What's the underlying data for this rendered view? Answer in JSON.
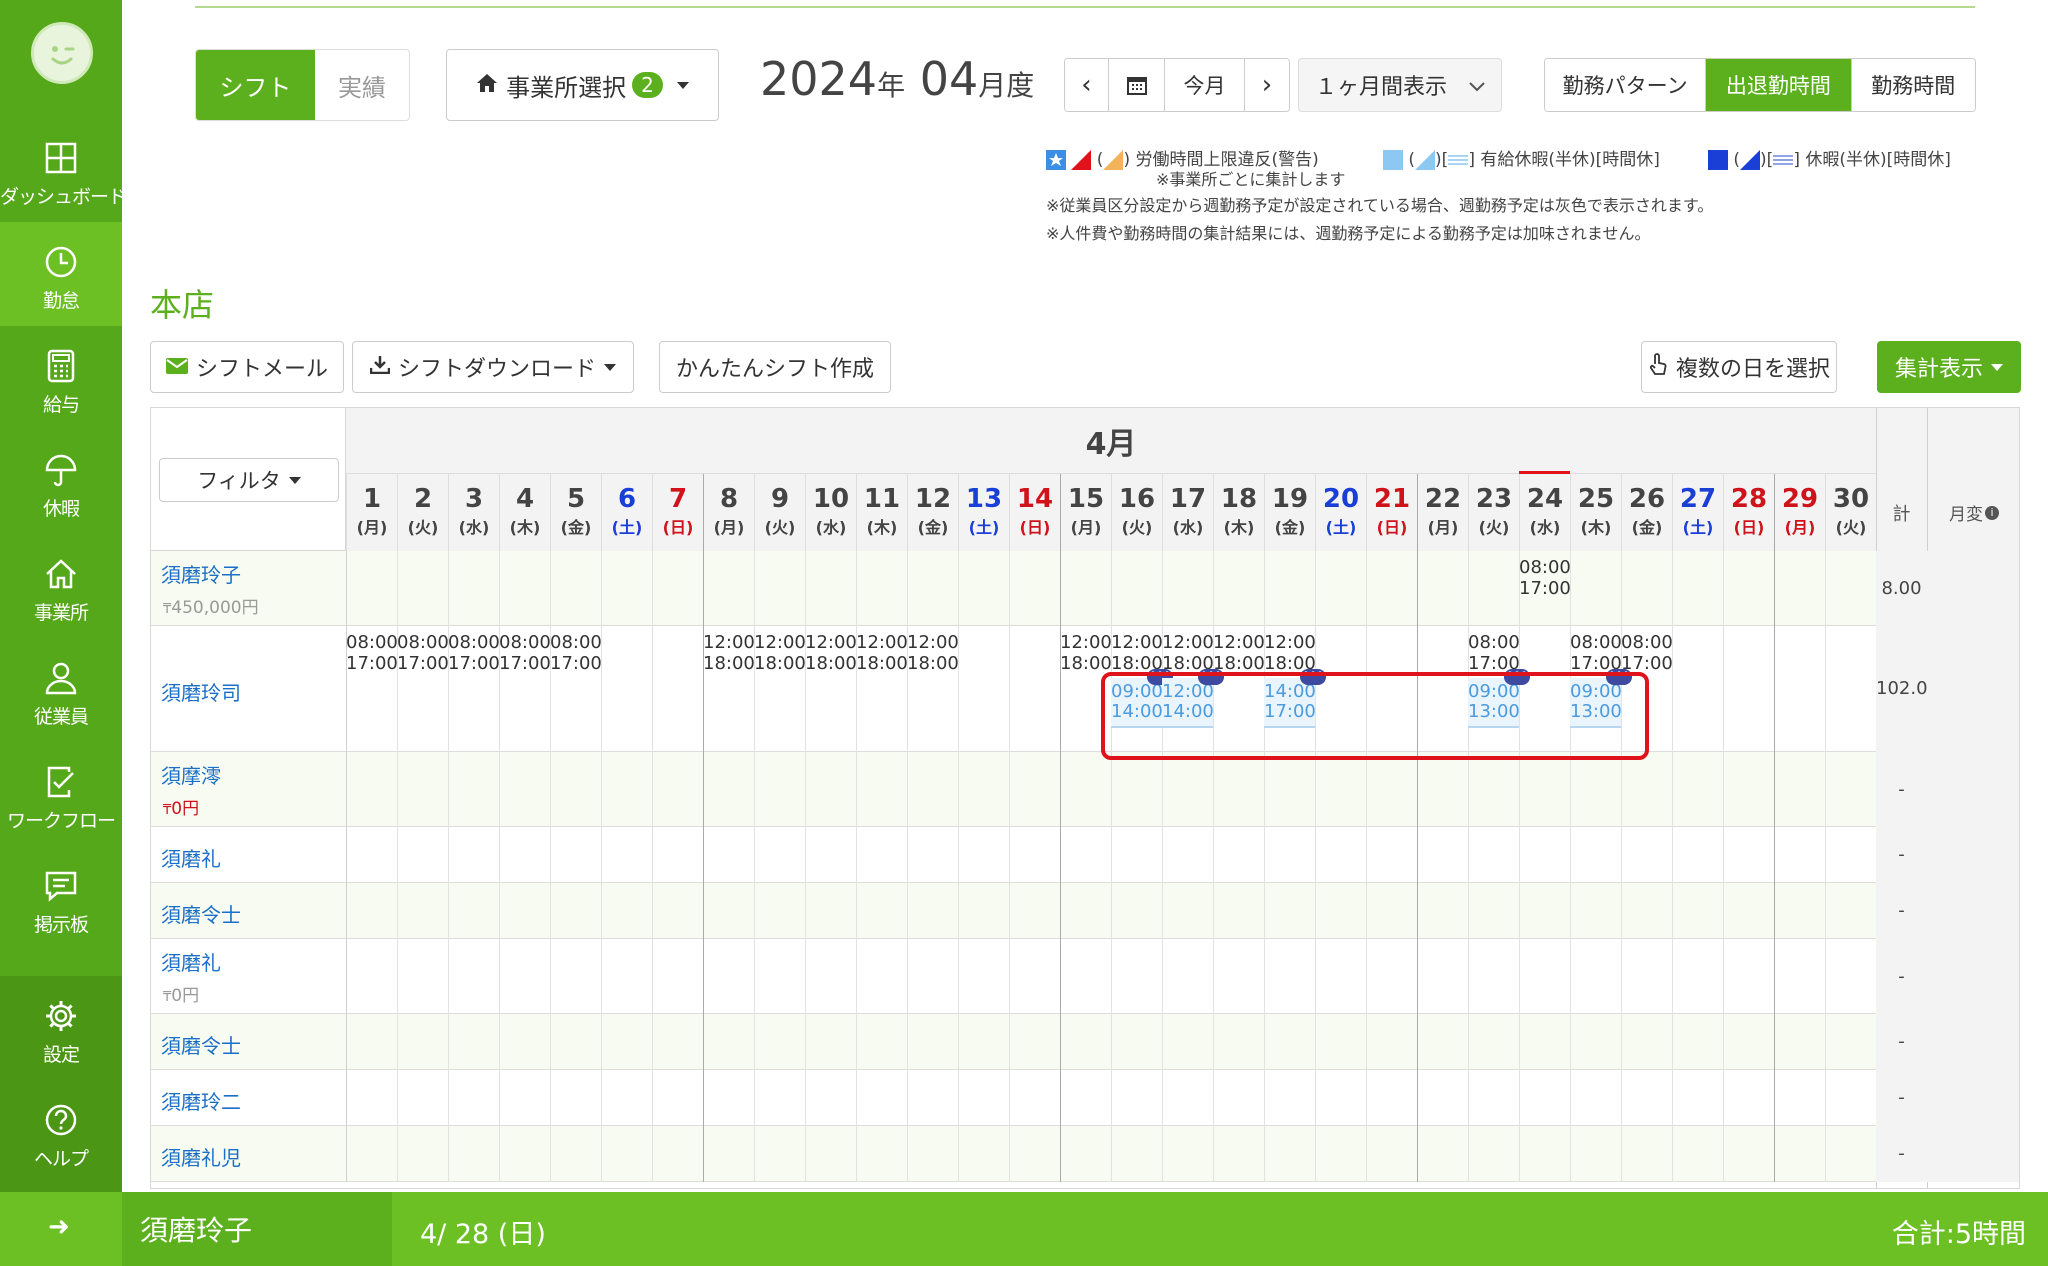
{
  "sidebar": {
    "items": [
      {
        "label": "ダッシュボード",
        "icon": "dashboard-icon"
      },
      {
        "label": "勤怠",
        "icon": "clock-icon"
      },
      {
        "label": "給与",
        "icon": "calculator-icon"
      },
      {
        "label": "休暇",
        "icon": "umbrella-icon"
      },
      {
        "label": "事業所",
        "icon": "home-icon"
      },
      {
        "label": "従業員",
        "icon": "person-icon"
      },
      {
        "label": "ワークフロー",
        "icon": "checklist-icon"
      },
      {
        "label": "掲示板",
        "icon": "chat-icon"
      },
      {
        "label": "設定",
        "icon": "gear-icon"
      },
      {
        "label": "ヘルプ",
        "icon": "help-icon"
      }
    ]
  },
  "toggle": {
    "shift": "シフト",
    "actual": "実績"
  },
  "office_select": {
    "label": "事業所選択",
    "count": "2"
  },
  "period": {
    "year": "2024",
    "year_unit": "年",
    "month": "04",
    "month_unit": "月度"
  },
  "nav": {
    "prev": "‹",
    "today": "今月",
    "next": "›",
    "range": "１ヶ月間表示"
  },
  "view_tabs": [
    "勤務パターン",
    "出退勤時間",
    "勤務時間"
  ],
  "legend": {
    "overtime": "労働時間上限違反(警告)",
    "overtime_note": "※事業所ごとに集計します",
    "paid_leave": "有給休暇(半休)[時間休]",
    "leave": "休暇(半休)[時間休]",
    "note1": "※従業員区分設定から週勤務予定が設定されている場合、週勤務予定は灰色で表示されます。",
    "note2": "※人件費や勤務時間の集計結果には、週勤務予定による勤務予定は加味されません。"
  },
  "store_name": "本店",
  "actions": {
    "shift_mail": "シフトメール",
    "shift_download": "シフトダウンロード",
    "easy_shift": "かんたんシフト作成",
    "multi_select": "複数の日を選択",
    "summary": "集計表示"
  },
  "grid": {
    "filter": "フィルタ",
    "month": "4月",
    "total_header": "計",
    "monthly_change_header": "月変",
    "days": [
      {
        "d": "1",
        "w": "(月)",
        "c": ""
      },
      {
        "d": "2",
        "w": "(火)",
        "c": ""
      },
      {
        "d": "3",
        "w": "(水)",
        "c": ""
      },
      {
        "d": "4",
        "w": "(木)",
        "c": ""
      },
      {
        "d": "5",
        "w": "(金)",
        "c": ""
      },
      {
        "d": "6",
        "w": "(土)",
        "c": "sat"
      },
      {
        "d": "7",
        "w": "(日)",
        "c": "sun"
      },
      {
        "d": "8",
        "w": "(月)",
        "c": ""
      },
      {
        "d": "9",
        "w": "(火)",
        "c": ""
      },
      {
        "d": "10",
        "w": "(水)",
        "c": ""
      },
      {
        "d": "11",
        "w": "(木)",
        "c": ""
      },
      {
        "d": "12",
        "w": "(金)",
        "c": ""
      },
      {
        "d": "13",
        "w": "(土)",
        "c": "sat"
      },
      {
        "d": "14",
        "w": "(日)",
        "c": "sun"
      },
      {
        "d": "15",
        "w": "(月)",
        "c": ""
      },
      {
        "d": "16",
        "w": "(火)",
        "c": ""
      },
      {
        "d": "17",
        "w": "(水)",
        "c": ""
      },
      {
        "d": "18",
        "w": "(木)",
        "c": ""
      },
      {
        "d": "19",
        "w": "(金)",
        "c": ""
      },
      {
        "d": "20",
        "w": "(土)",
        "c": "sat"
      },
      {
        "d": "21",
        "w": "(日)",
        "c": "sun"
      },
      {
        "d": "22",
        "w": "(月)",
        "c": ""
      },
      {
        "d": "23",
        "w": "(火)",
        "c": ""
      },
      {
        "d": "24",
        "w": "(水)",
        "c": "today"
      },
      {
        "d": "25",
        "w": "(木)",
        "c": ""
      },
      {
        "d": "26",
        "w": "(金)",
        "c": ""
      },
      {
        "d": "27",
        "w": "(土)",
        "c": "sat"
      },
      {
        "d": "28",
        "w": "(日)",
        "c": "sun"
      },
      {
        "d": "29",
        "w": "(月)",
        "c": "sun"
      },
      {
        "d": "30",
        "w": "(火)",
        "c": ""
      }
    ],
    "employees": [
      {
        "name": "須磨玲子",
        "salary": "450,000円",
        "total": "8.00",
        "shifts": [
          {
            "day": 24,
            "s": "08:00",
            "e": "17:00"
          }
        ],
        "requests": []
      },
      {
        "name": "須磨玲司",
        "salary": "",
        "total": "102.0",
        "shifts": [
          {
            "day": 1,
            "s": "08:00",
            "e": "17:00"
          },
          {
            "day": 2,
            "s": "08:00",
            "e": "17:00"
          },
          {
            "day": 3,
            "s": "08:00",
            "e": "17:00"
          },
          {
            "day": 4,
            "s": "08:00",
            "e": "17:00"
          },
          {
            "day": 5,
            "s": "08:00",
            "e": "17:00"
          },
          {
            "day": 8,
            "s": "12:00",
            "e": "18:00"
          },
          {
            "day": 9,
            "s": "12:00",
            "e": "18:00"
          },
          {
            "day": 10,
            "s": "12:00",
            "e": "18:00"
          },
          {
            "day": 11,
            "s": "12:00",
            "e": "18:00"
          },
          {
            "day": 12,
            "s": "12:00",
            "e": "18:00"
          },
          {
            "day": 15,
            "s": "12:00",
            "e": "18:00"
          },
          {
            "day": 16,
            "s": "12:00",
            "e": "18:00"
          },
          {
            "day": 17,
            "s": "12:00",
            "e": "18:00"
          },
          {
            "day": 18,
            "s": "12:00",
            "e": "18:00"
          },
          {
            "day": 19,
            "s": "12:00",
            "e": "18:00"
          },
          {
            "day": 23,
            "s": "08:00",
            "e": "17:00"
          },
          {
            "day": 25,
            "s": "08:00",
            "e": "17:00"
          },
          {
            "day": 26,
            "s": "08:00",
            "e": "17:00"
          }
        ],
        "requests": [
          {
            "day": 16,
            "s": "09:00",
            "e": "14:00"
          },
          {
            "day": 17,
            "s": "12:00",
            "e": "14:00"
          },
          {
            "day": 19,
            "s": "14:00",
            "e": "17:00"
          },
          {
            "day": 23,
            "s": "09:00",
            "e": "13:00"
          },
          {
            "day": 25,
            "s": "09:00",
            "e": "13:00"
          }
        ]
      },
      {
        "name": "須摩澪",
        "salary": "0円",
        "salary_red": true,
        "total": "-",
        "shifts": [],
        "requests": []
      },
      {
        "name": "須磨礼",
        "salary": "",
        "total": "-",
        "shifts": [],
        "requests": []
      },
      {
        "name": "須磨令士",
        "salary": "",
        "total": "-",
        "shifts": [],
        "requests": []
      },
      {
        "name": "須磨礼",
        "salary": "0円",
        "total": "-",
        "shifts": [],
        "requests": []
      },
      {
        "name": "須磨令士",
        "salary": "",
        "total": "-",
        "shifts": [],
        "requests": []
      },
      {
        "name": "須磨玲二",
        "salary": "",
        "total": "-",
        "shifts": [],
        "requests": []
      },
      {
        "name": "須磨礼児",
        "salary": "",
        "total": "-",
        "shifts": [],
        "requests": []
      }
    ]
  },
  "footer": {
    "arrow": "➜",
    "name": "須磨玲子",
    "date": "4/ 28 (日)",
    "total": "合計:5時間"
  },
  "colors": {
    "primary": "#5cb01e",
    "sidebar": "#55a819",
    "sat": "#1a3fd6",
    "sun": "#d0121b",
    "highlight": "#e0121b"
  }
}
